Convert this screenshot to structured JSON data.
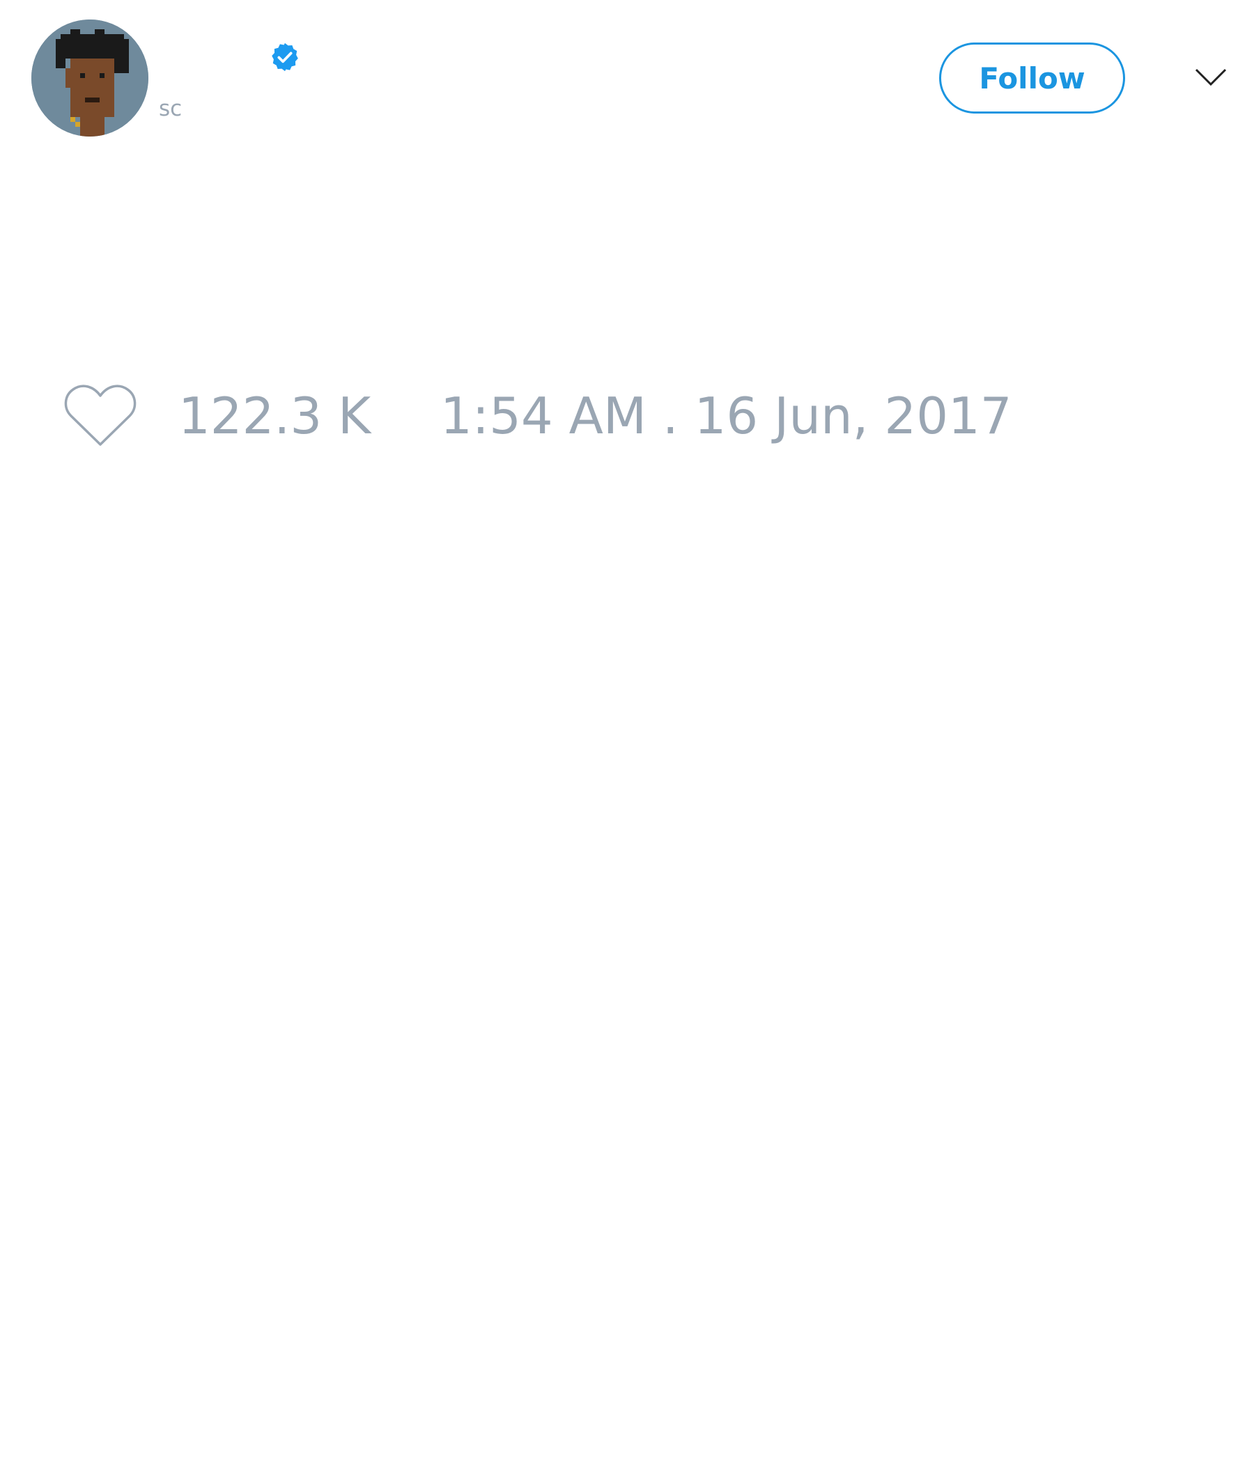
{
  "tweet": {
    "author": {
      "handle": "sc",
      "avatar_icon": "pixel-punk-avatar",
      "verified_icon": "verified-badge-icon"
    },
    "follow_button_label": "Follow",
    "menu_icon": "chevron-down-icon",
    "like_icon": "heart-outline-icon",
    "like_count": "122.3 K",
    "timestamp": "1:54 AM . 16 Jun, 2017"
  },
  "colors": {
    "accent": "#1b95e0",
    "muted_text": "#9aa6b3",
    "background": "#ffffff"
  }
}
